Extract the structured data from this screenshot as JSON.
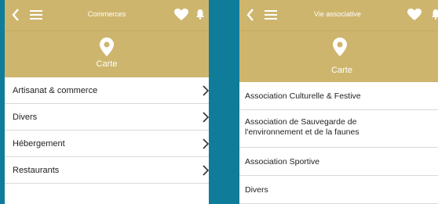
{
  "left_screen": {
    "header_title": "Commerces",
    "carte_label": "Carte",
    "items": [
      {
        "label": "Artisanat & commerce"
      },
      {
        "label": "Divers"
      },
      {
        "label": "Hébergement"
      },
      {
        "label": "Restaurants"
      }
    ]
  },
  "right_screen": {
    "header_title": "Vie associative",
    "carte_label": "Carte",
    "items": [
      {
        "label": "Association Culturelle & Festive"
      },
      {
        "label": "Association de Sauvegarde de l'environnement et de la faunes"
      },
      {
        "label": "Association Sportive"
      },
      {
        "label": "Divers"
      }
    ]
  },
  "icons": {
    "back": "chevron-left-icon",
    "menu": "hamburger-menu-icon",
    "favorite": "heart-icon",
    "notifications": "bell-icon",
    "map": "map-pin-icon",
    "row": "chevron-right-icon"
  },
  "colors": {
    "background": "#0f7c9a",
    "header": "#ceb56d",
    "text_on_header": "#ffffff",
    "list_text": "#222222",
    "divider": "#d9d9d9"
  }
}
